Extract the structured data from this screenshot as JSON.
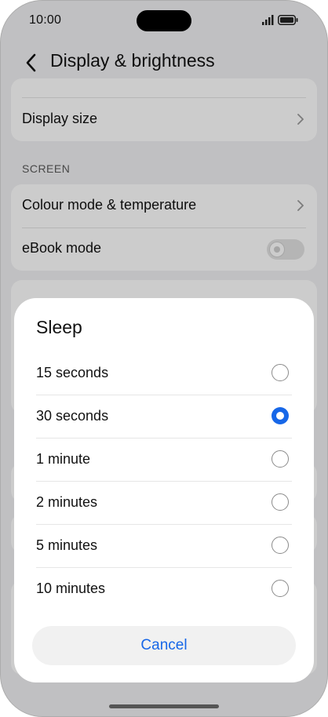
{
  "status_bar": {
    "time": "10:00"
  },
  "header": {
    "title": "Display & brightness"
  },
  "settings": {
    "display_size": "Display size",
    "section_screen": "SCREEN",
    "colour_mode": "Colour mode & temperature",
    "ebook_mode": "eBook mode",
    "ebook_enabled": false
  },
  "sheet": {
    "title": "Sleep",
    "options": [
      {
        "label": "15 seconds",
        "selected": false
      },
      {
        "label": "30 seconds",
        "selected": true
      },
      {
        "label": "1 minute",
        "selected": false
      },
      {
        "label": "2 minutes",
        "selected": false
      },
      {
        "label": "5 minutes",
        "selected": false
      },
      {
        "label": "10 minutes",
        "selected": false
      }
    ],
    "cancel": "Cancel"
  },
  "colors": {
    "accent": "#1767e8",
    "background": "#f1f1f3"
  }
}
